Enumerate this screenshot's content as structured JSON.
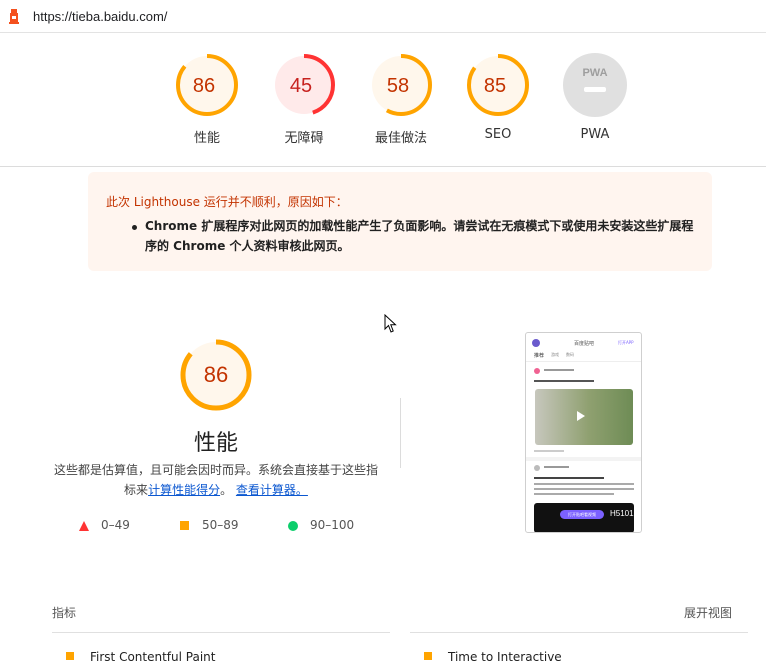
{
  "browser": {
    "url": "https://tieba.baidu.com/"
  },
  "categories": [
    {
      "label": "性能",
      "score": 86,
      "type": "average"
    },
    {
      "label": "无障碍",
      "score": 45,
      "type": "fail"
    },
    {
      "label": "最佳做法",
      "score": 58,
      "type": "average"
    },
    {
      "label": "SEO",
      "score": 85,
      "type": "average"
    },
    {
      "label": "PWA",
      "score": null,
      "type": "pwa",
      "badge": "PWA"
    }
  ],
  "warning": {
    "heading": "此次 Lighthouse 运行并不顺利，原因如下：",
    "item": "Chrome 扩展程序对此网页的加载性能产生了负面影响。请尝试在无痕模式下或使用未安装这些扩展程序的 Chrome 个人资料审核此网页。"
  },
  "performance": {
    "score": 86,
    "title": "性能",
    "desc_prefix": "这些都是估算值，且可能会因时而异。系统会直接基于这些指标来",
    "link_calc": "计算性能得分",
    "desc_mid": "。",
    "link_view": "查看计算器。",
    "legend": [
      {
        "shape": "triangle",
        "range": "0–49",
        "color": "#ff3333"
      },
      {
        "shape": "square",
        "range": "50–89",
        "color": "#ffa400"
      },
      {
        "shape": "circle",
        "range": "90–100",
        "color": "#0cce6b"
      }
    ]
  },
  "thumbnail": {
    "header": "百度贴吧",
    "open_app": "打开APP",
    "tabs": [
      "推荐",
      "游戏",
      "数码"
    ],
    "cta": "打开贴吧看视频",
    "banner_text": "H5101"
  },
  "metrics": {
    "label": "指标",
    "expand": "展开视图",
    "items": [
      "First Contentful Paint",
      "Time to Interactive"
    ]
  },
  "colors": {
    "average": "#ffa400",
    "average_bg": "#fff7ec",
    "average_text": "#c33300",
    "fail": "#ff3333",
    "fail_bg": "#ffeaea",
    "fail_text": "#c7221f",
    "pwa_bg": "#e0e0e0"
  }
}
